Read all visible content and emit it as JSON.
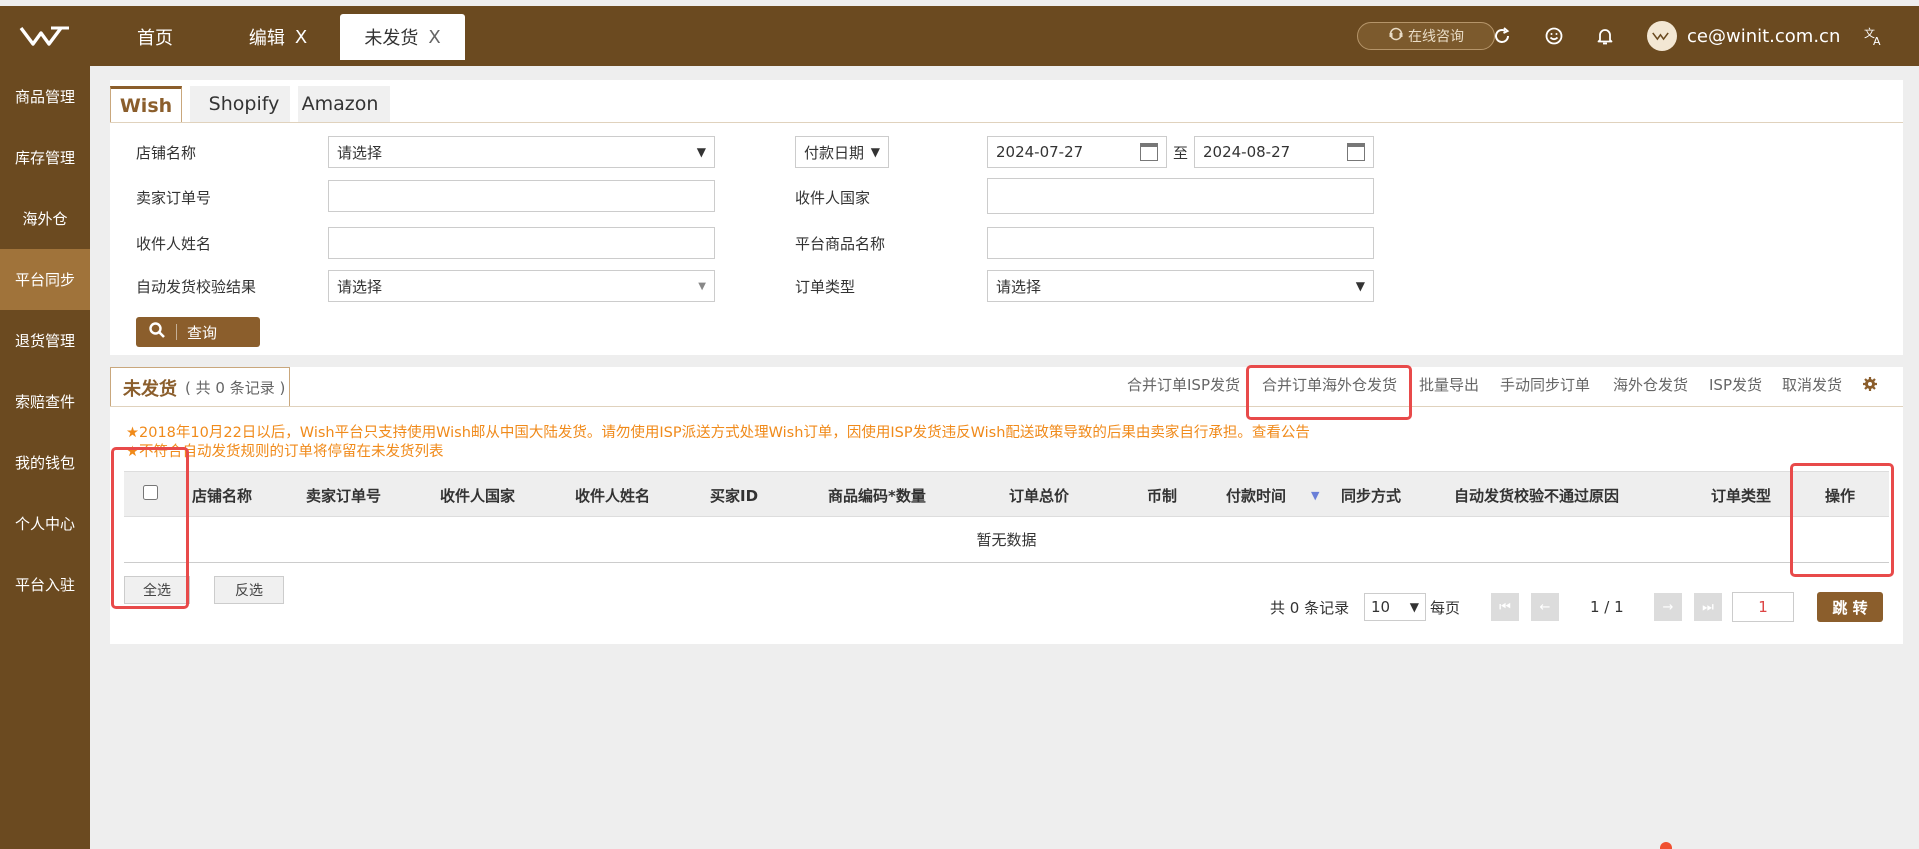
{
  "header": {
    "tabs": [
      {
        "label": "首页"
      },
      {
        "label": "编辑",
        "close": "X"
      },
      {
        "label": "未发货",
        "close": "X"
      }
    ],
    "consult_label": "在线咨询",
    "user_email": "ce@winit.com.cn"
  },
  "sidebar": {
    "items": [
      {
        "label": "商品管理"
      },
      {
        "label": "库存管理"
      },
      {
        "label": "海外仓"
      },
      {
        "label": "平台同步"
      },
      {
        "label": "退货管理"
      },
      {
        "label": "索赔查件"
      },
      {
        "label": "我的钱包"
      },
      {
        "label": "个人中心"
      },
      {
        "label": "平台入驻"
      }
    ],
    "active_index": 3
  },
  "platform_tabs": [
    "Wish",
    "Shopify",
    "Amazon"
  ],
  "filters": {
    "store_name_label": "店铺名称",
    "store_name_value": "请选择",
    "date_type_value": "付款日期",
    "date_from": "2024-07-27",
    "date_to_label": "至",
    "date_to": "2024-08-27",
    "seller_order_label": "卖家订单号",
    "recipient_country_label": "收件人国家",
    "recipient_name_label": "收件人姓名",
    "platform_product_label": "平台商品名称",
    "auto_check_label": "自动发货校验结果",
    "auto_check_value": "请选择",
    "order_type_label": "订单类型",
    "order_type_value": "请选择",
    "query_label": "查询"
  },
  "section": {
    "title": "未发货",
    "count_text": "( 共 0 条记录 )"
  },
  "actions": {
    "merge_isp": "合并订单ISP发货",
    "merge_overseas": "合并订单海外仓发货",
    "batch_export": "批量导出",
    "manual_sync": "手动同步订单",
    "overseas_ship": "海外仓发货",
    "isp_ship": "ISP发货",
    "cancel_ship": "取消发货"
  },
  "notices": [
    "2018年10月22日以后，Wish平台只支持使用Wish邮从中国大陆发货。请勿使用ISP派送方式处理Wish订单，因使用ISP发货违反Wish配送政策导致的后果由卖家自行承担。查看公告",
    "不符合自动发货规则的订单将停留在未发货列表"
  ],
  "table": {
    "columns": [
      "店铺名称",
      "卖家订单号",
      "收件人国家",
      "收件人姓名",
      "买家ID",
      "商品编码*数量",
      "订单总价",
      "币制",
      "付款时间",
      "同步方式",
      "自动发货校验不通过原因",
      "订单类型",
      "操作"
    ],
    "empty_text": "暂无数据"
  },
  "bulk": {
    "select_all": "全选",
    "invert": "反选"
  },
  "pager": {
    "total_text": "共 0 条记录",
    "page_size": "10",
    "per_page_label": "每页",
    "page_info": "1 / 1",
    "page_input": "1",
    "jump_label": "跳 转"
  },
  "colors": {
    "brand_brown": "#6b4a20",
    "accent_brown": "#8b5e2c",
    "notice_orange": "#f08a1a",
    "highlight_red": "#e84a4a"
  }
}
